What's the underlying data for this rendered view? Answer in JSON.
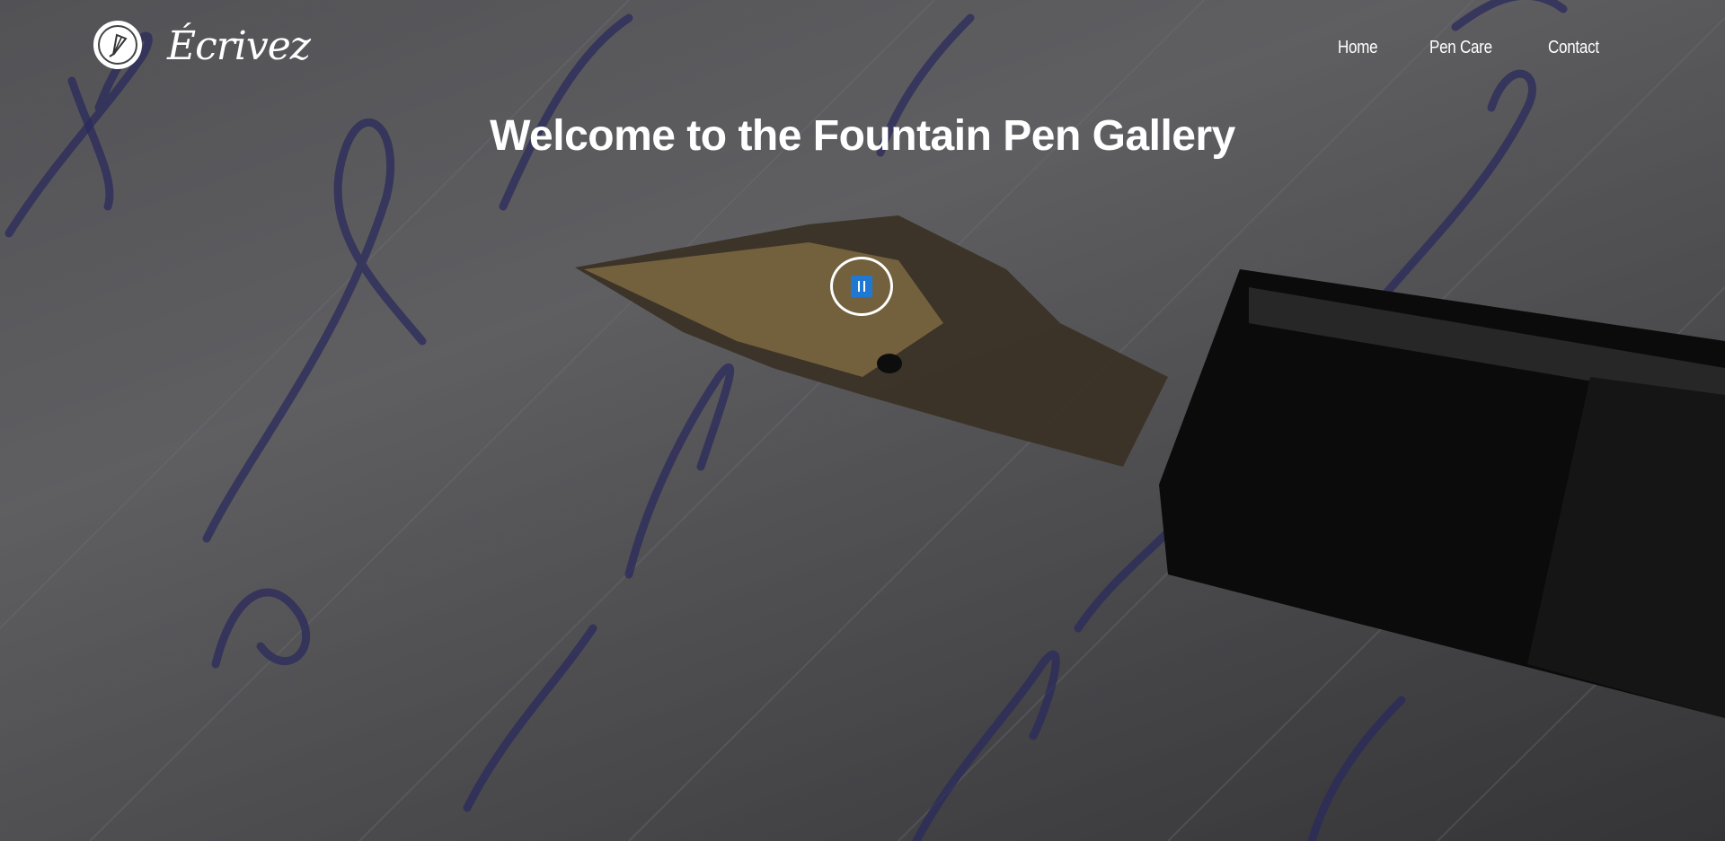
{
  "brand": {
    "name": "Écrivez",
    "logo_icon": "fountain-pen-nib-icon"
  },
  "nav": {
    "items": [
      {
        "label": "Home"
      },
      {
        "label": "Pen Care"
      },
      {
        "label": "Contact"
      }
    ]
  },
  "hero": {
    "title": "Welcome to the Fountain Pen Gallery",
    "video_control": {
      "icon": "pause-icon",
      "accent_color": "#1f78d1"
    }
  }
}
